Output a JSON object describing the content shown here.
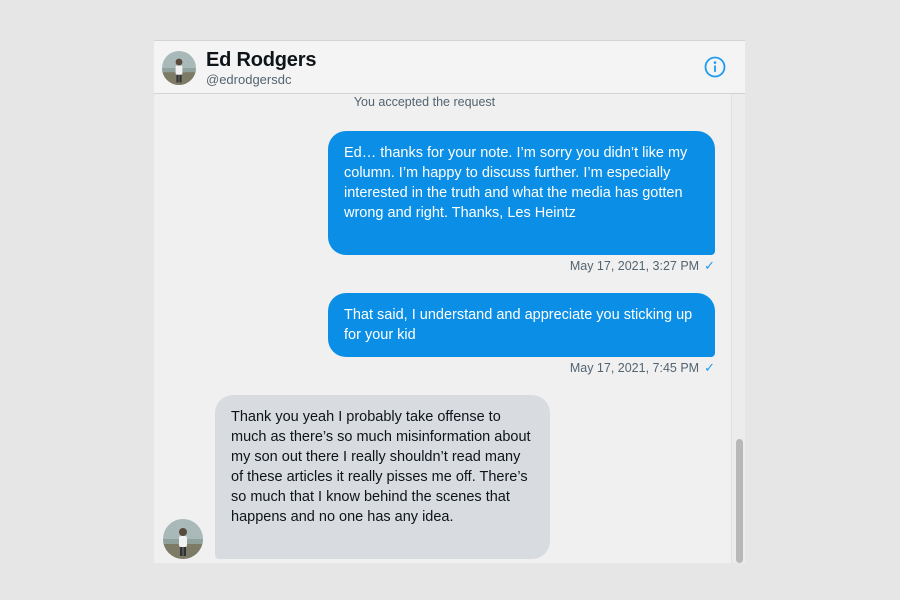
{
  "header": {
    "name": "Ed Rodgers",
    "handle": "@edrodgersdc",
    "info_icon": "info-icon"
  },
  "system_note": "You accepted the request",
  "messages": [
    {
      "direction": "outgoing",
      "text": "Ed… thanks for your note. I’m sorry you didn’t like my column. I’m happy to discuss further. I’m especially interested in the truth and what the media has gotten wrong and right. Thanks, Les Heintz",
      "timestamp": "May 17, 2021, 3:27 PM",
      "status_icon": "checkmark-icon"
    },
    {
      "direction": "outgoing",
      "text": "That said, I understand and appreciate you sticking up for your kid",
      "timestamp": "May 17, 2021, 7:45 PM",
      "status_icon": "checkmark-icon"
    },
    {
      "direction": "incoming",
      "text": "Thank you yeah I probably take offense to much as there’s so much misinformation about my son out there I really shouldn’t read many of these articles it really pisses me off. There’s so much that I know behind the scenes that happens and no one has any idea."
    }
  ],
  "colors": {
    "outgoing_bubble": "#0b8fe6",
    "incoming_bubble": "#d8dce0",
    "accent": "#1d9bf0",
    "background": "#f0f0f0"
  }
}
